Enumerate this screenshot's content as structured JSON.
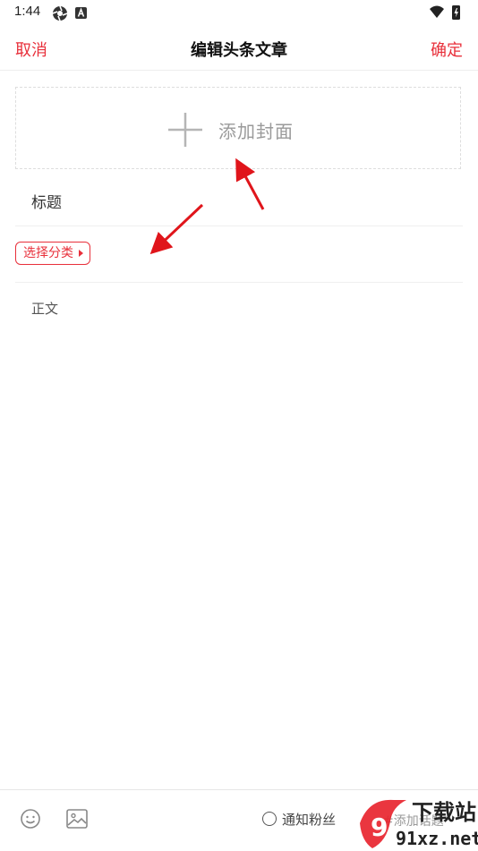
{
  "status_bar": {
    "time": "1:44",
    "icons": [
      "settings-icon",
      "accessibility-icon",
      "wifi-icon",
      "battery-icon"
    ]
  },
  "header": {
    "cancel_label": "取消",
    "title": "编辑头条文章",
    "confirm_label": "确定"
  },
  "cover": {
    "label": "添加封面",
    "icon": "plus-icon"
  },
  "form": {
    "title_placeholder": "标题",
    "category_label": "选择分类",
    "body_placeholder": "正文"
  },
  "toolbar": {
    "notify_label": "通知粉丝",
    "tag_label": "#添加话题",
    "icons": [
      "emoji-icon",
      "image-icon",
      "radio-icon"
    ]
  },
  "watermark": {
    "line1": "下载站",
    "line2": "91xz.net"
  },
  "colors": {
    "accent": "#e8303b",
    "annotation_arrow": "#e0151b"
  }
}
